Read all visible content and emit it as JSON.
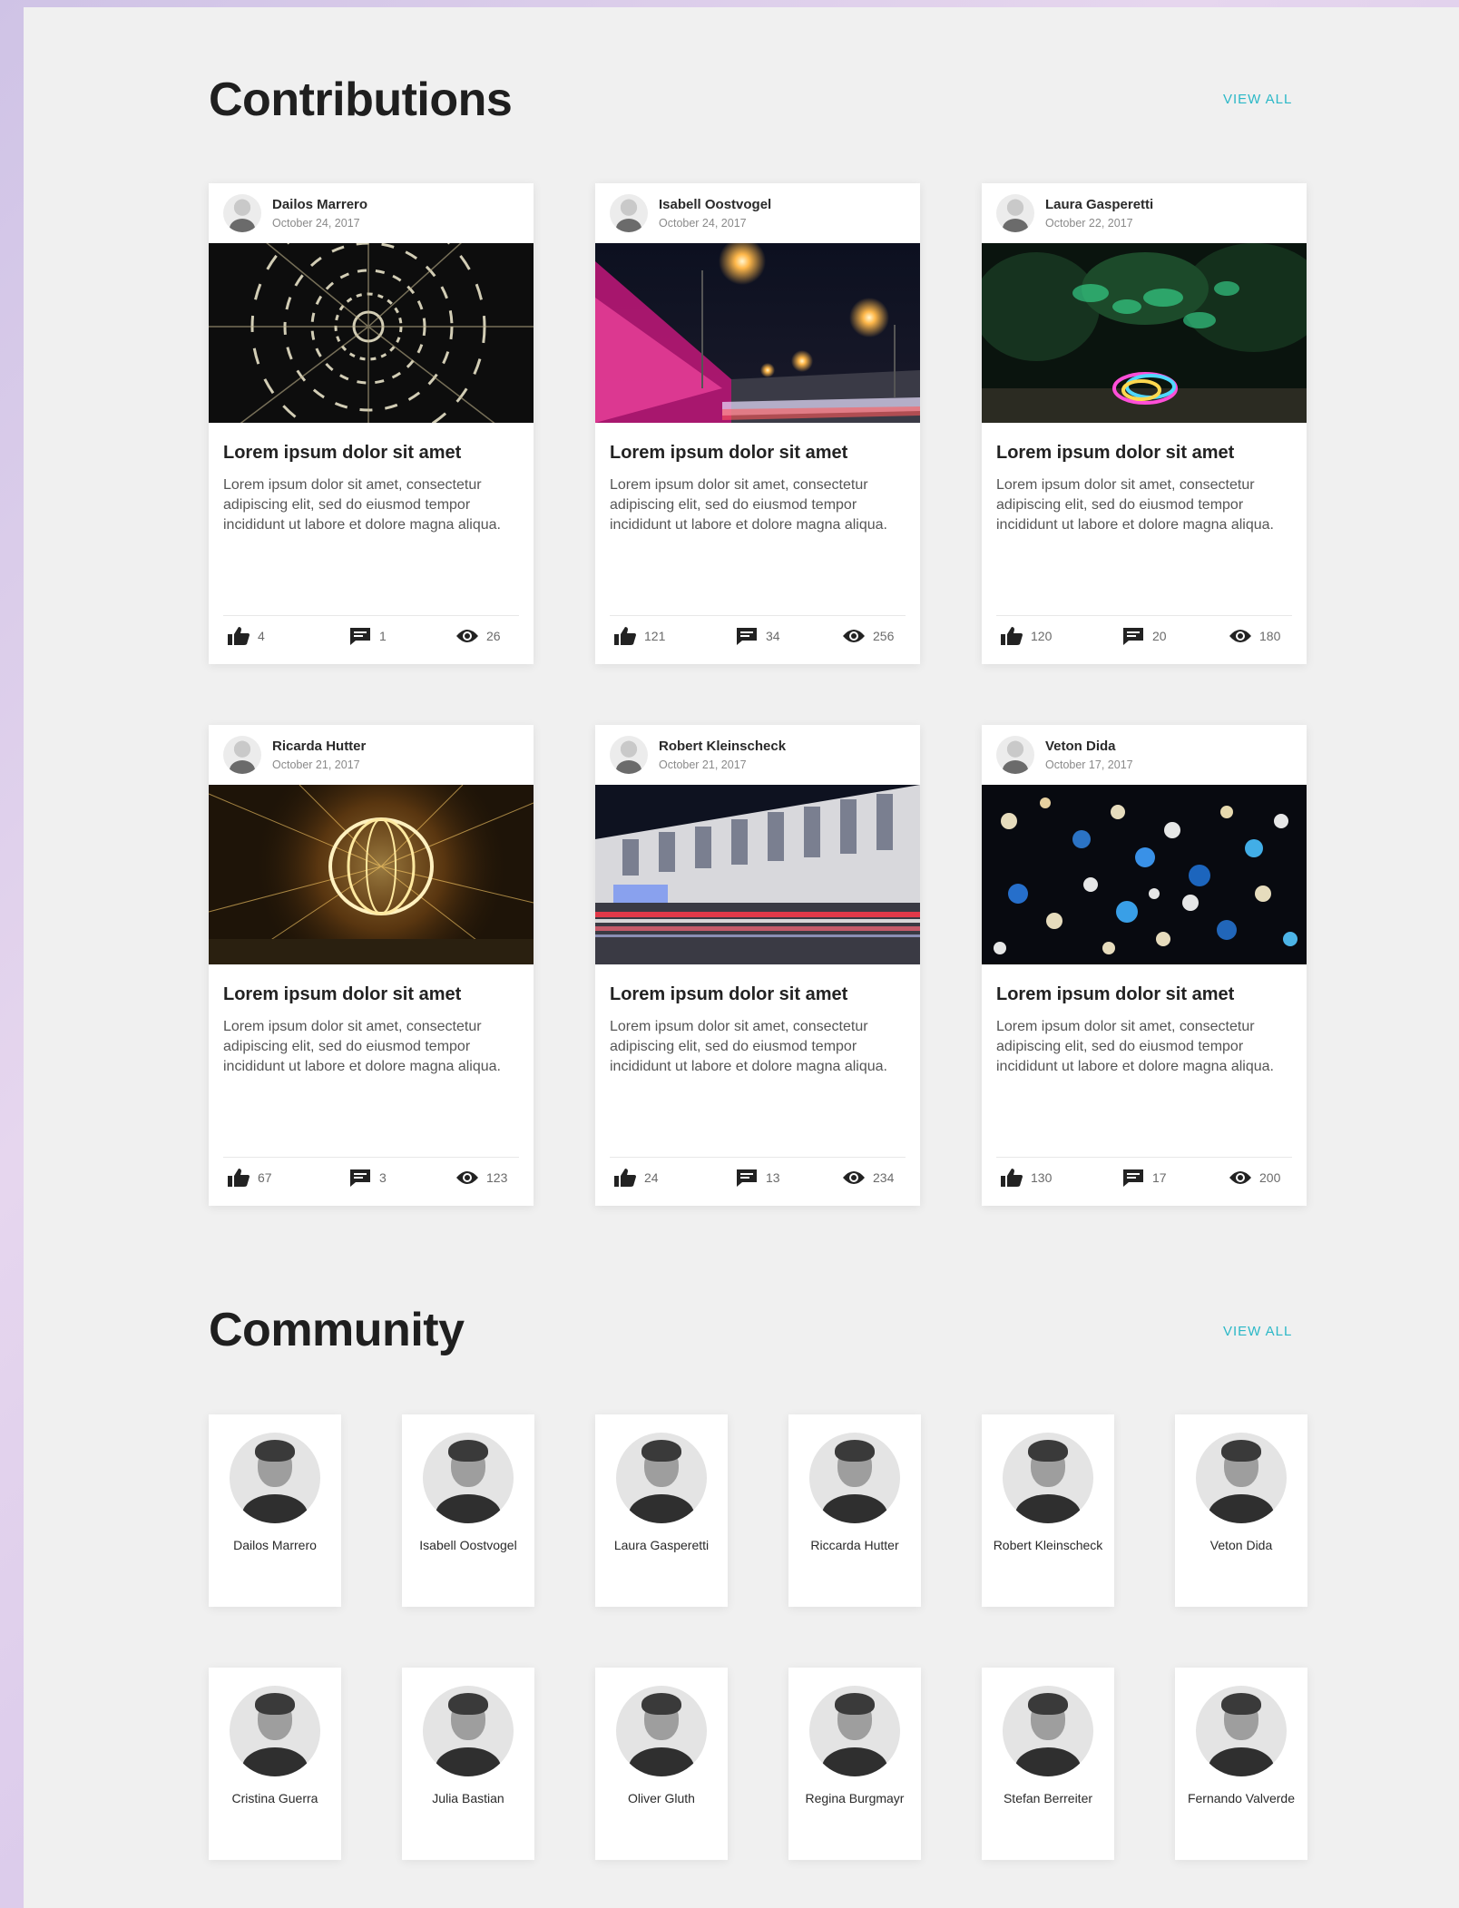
{
  "contributions": {
    "title": "Contributions",
    "view_all": "VIEW ALL",
    "cards": [
      {
        "author": "Dailos Marrero",
        "date": "October 24, 2017",
        "title": "Lorem ipsum dolor sit amet",
        "text": "Lorem ipsum dolor sit amet, consectetur adipiscing elit, sed do eiusmod tempor incididunt ut labore et dolore magna aliqua.",
        "likes": "4",
        "comments": "1",
        "views": "26"
      },
      {
        "author": "Isabell Oostvogel",
        "date": "October 24, 2017",
        "title": "Lorem ipsum dolor sit amet",
        "text": "Lorem ipsum dolor sit amet, consectetur adipiscing elit, sed do eiusmod tempor incididunt ut labore et dolore magna aliqua.",
        "likes": "121",
        "comments": "34",
        "views": "256"
      },
      {
        "author": "Laura Gasperetti",
        "date": "October 22, 2017",
        "title": "Lorem ipsum dolor sit amet",
        "text": "Lorem ipsum dolor sit amet, consectetur adipiscing elit, sed do eiusmod tempor incididunt ut labore et dolore magna aliqua.",
        "likes": "120",
        "comments": "20",
        "views": "180"
      },
      {
        "author": "Ricarda Hutter",
        "date": "October 21, 2017",
        "title": "Lorem ipsum dolor sit amet",
        "text": "Lorem ipsum dolor sit amet, consectetur adipiscing elit, sed do eiusmod tempor incididunt ut labore et dolore magna aliqua.",
        "likes": "67",
        "comments": "3",
        "views": "123"
      },
      {
        "author": "Robert Kleinscheck",
        "date": "October 21, 2017",
        "title": "Lorem ipsum dolor sit amet",
        "text": "Lorem ipsum dolor sit amet, consectetur adipiscing elit, sed do eiusmod tempor incididunt ut labore et dolore magna aliqua.",
        "likes": "24",
        "comments": "13",
        "views": "234"
      },
      {
        "author": "Veton Dida",
        "date": "October 17, 2017",
        "title": "Lorem ipsum dolor sit amet",
        "text": "Lorem ipsum dolor sit amet, consectetur adipiscing elit, sed do eiusmod tempor incididunt ut labore et dolore magna aliqua.",
        "likes": "130",
        "comments": "17",
        "views": "200"
      }
    ]
  },
  "community": {
    "title": "Community",
    "view_all": "VIEW ALL",
    "members": [
      {
        "name": "Dailos Marrero"
      },
      {
        "name": "Isabell Oostvogel"
      },
      {
        "name": "Laura Gasperetti"
      },
      {
        "name": "Riccarda Hutter"
      },
      {
        "name": "Robert Kleinscheck"
      },
      {
        "name": "Veton Dida"
      },
      {
        "name": "Cristina Guerra"
      },
      {
        "name": "Julia Bastian"
      },
      {
        "name": "Oliver Gluth"
      },
      {
        "name": "Regina Burgmayr"
      },
      {
        "name": "Stefan Berreiter"
      },
      {
        "name": "Fernando Valverde"
      }
    ]
  },
  "icons": {
    "like": "thumb-up-icon",
    "comment": "comment-icon",
    "view": "eye-icon"
  },
  "colors": {
    "accent": "#2bb8c7",
    "page_bg": "#f0f0f0",
    "card_bg": "#ffffff"
  }
}
